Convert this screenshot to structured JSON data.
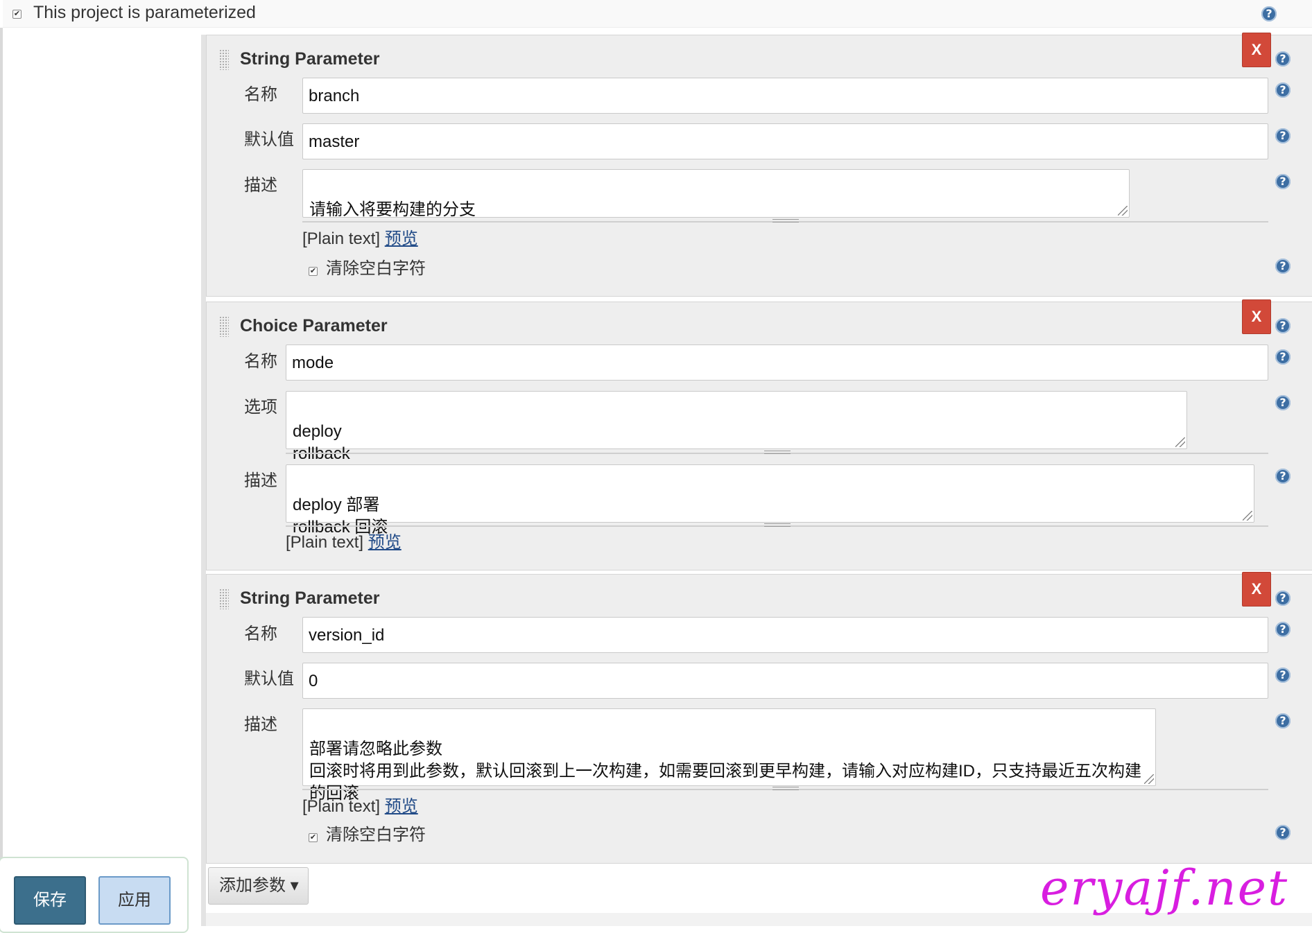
{
  "top": {
    "checked": true,
    "label": "This project is parameterized"
  },
  "params": [
    {
      "type": "String Parameter",
      "delete_label": "X",
      "name_label": "名称",
      "name_value": "branch",
      "default_label": "默认值",
      "default_value": "master",
      "desc_label": "描述",
      "desc_value": "请输入将要构建的分支",
      "plain_text": "[Plain text]",
      "preview": "预览",
      "trim_label": "清除空白字符",
      "trim_checked": true
    },
    {
      "type": "Choice Parameter",
      "delete_label": "X",
      "name_label": "名称",
      "name_value": "mode",
      "choices_label": "选项",
      "choices_value": "deploy\nrollback",
      "desc_label": "描述",
      "desc_value": "deploy   部署\nrollback 回滚",
      "plain_text": "[Plain text]",
      "preview": "预览"
    },
    {
      "type": "String Parameter",
      "delete_label": "X",
      "name_label": "名称",
      "name_value": "version_id",
      "default_label": "默认值",
      "default_value": "0",
      "desc_label": "描述",
      "desc_value": "部署请忽略此参数\n回滚时将用到此参数，默认回滚到上一次构建，如需要回滚到更早构建，请输入对应构建ID，只支持最近五次构建\n的回滚",
      "plain_text": "[Plain text]",
      "preview": "预览",
      "trim_label": "清除空白字符",
      "trim_checked": true
    }
  ],
  "add_param_label": "添加参数 ▾",
  "save_label": "保存",
  "apply_label": "应用",
  "watermark": "eryajf.net",
  "help_glyph": "?",
  "check_glyph": "✔",
  "colors": {
    "delete": "#d24939",
    "save": "#3c6f8c",
    "apply": "#c8dcf2",
    "link": "#204a87",
    "help": "#3d6ea3",
    "watermark": "#d81ee0"
  }
}
